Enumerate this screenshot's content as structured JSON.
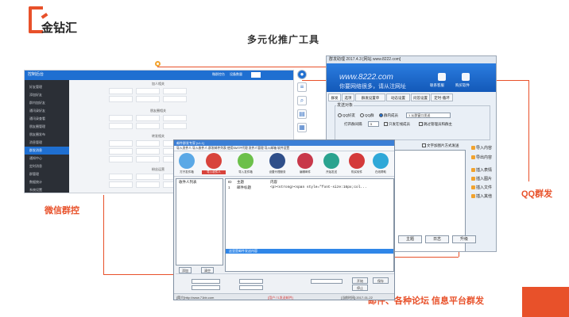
{
  "brand": {
    "name": "金钻汇",
    "accent": "#e8512a"
  },
  "page_title": "多元化推广工具",
  "labels": {
    "wechat": "微信群控",
    "qq": "QQ群发",
    "mail_forum": "邮件、各种论坛 信息平台群发"
  },
  "wechat_window": {
    "title": "控制后台",
    "top_links": [
      "微群控台",
      "设备数量"
    ],
    "sidebar": [
      "好友管理",
      "添加好友",
      "群内加好友",
      "通讯录好友",
      "通讯录查看",
      "朋友圈管理",
      "朋友圈发布",
      "消息管理",
      "群发消息",
      "通知中心",
      "定时消息",
      "群管理",
      "数据统计",
      "系统设置"
    ],
    "section1": "加人相关",
    "section2": "朋友圈相关",
    "section3": "转发相关",
    "section4": "粉丝运营"
  },
  "qq_window": {
    "title": "群发助理 2017.4.3 [网站 www.8222.com]",
    "url": "www.8222.com",
    "slogan": "你要网络很多，请从注网址",
    "icons": [
      "联系客服",
      "购买软件"
    ],
    "tabs": [
      "群发",
      "选项",
      "群发设置单",
      "动态设置",
      "问答设置",
      "定时·循环"
    ],
    "group_label": "发送对象",
    "radios": [
      "QQ好友",
      "QQ群",
      "群内成员"
    ],
    "select": "1 从群窗口发送",
    "interval_label": "打开群间隔",
    "interval_value": "5",
    "checks": [
      "只发在线成员",
      "跳过管理员和群主"
    ],
    "content_tab": "发送单个消息",
    "content_label": "发送内容",
    "content_tail": "文字加图片方式发送",
    "side_items": [
      "导入内容",
      "导出内容",
      "插入表情",
      "插入图片",
      "插入文件",
      "插入其他"
    ],
    "footer": [
      "主题",
      "日志",
      "升级"
    ]
  },
  "mail_window": {
    "title": "邮件群发专家 [v1.1]",
    "menu": "导入发件人  导入收件人  群发邮件列表  使用SMTP代理  发件人管理  导入邮箱  软件设置",
    "toolbar": [
      "打开发件箱",
      "导入收件人",
      "导入发件箱",
      "设置代理服务",
      "编辑邮件",
      "开始发送",
      "购买软件",
      "在线帮助"
    ],
    "left_header": "收件人列表",
    "table_headers": [
      "ID",
      "主题",
      "内容"
    ],
    "row": {
      "id": "1",
      "subject": "邮件标题",
      "content": "<p><strong><span style=\"font-size:16px;col..."
    },
    "selected_row": "这里是邮件发送内容",
    "bottom": {
      "a": "添加",
      "b": "清空",
      "open": "开始",
      "stop": "停止",
      "save": "保存"
    },
    "status_left": "[简介]http://www.71bb.com",
    "status_mid": "[用户:71发送邮件]",
    "status_right": "[当前时间]:2017-01-22"
  }
}
